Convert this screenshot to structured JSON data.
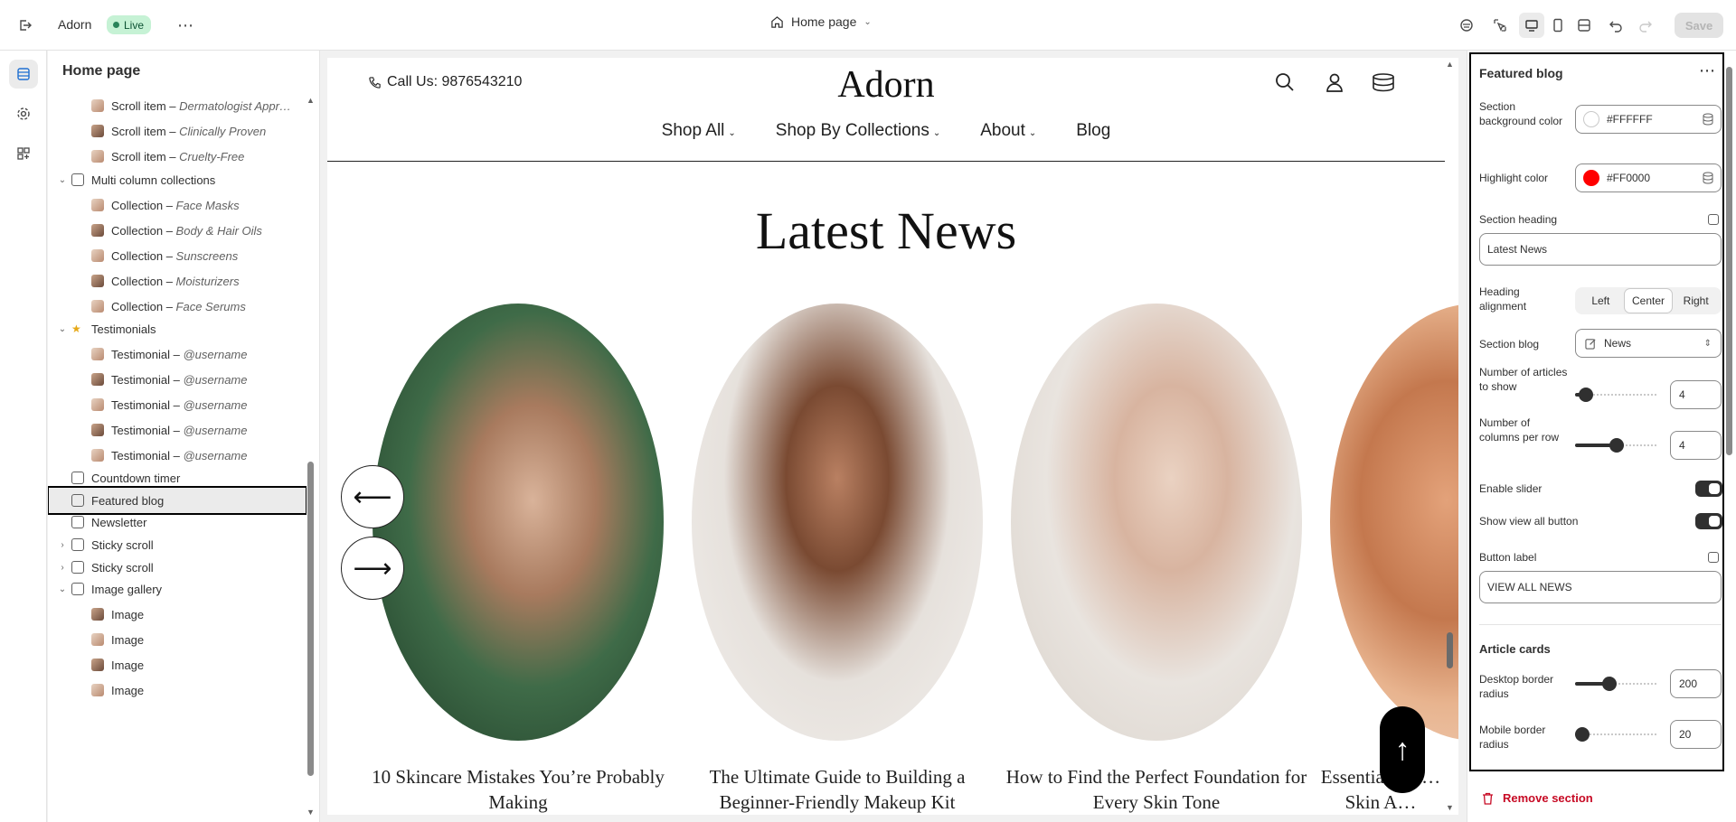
{
  "topbar": {
    "store_name": "Adorn",
    "status_badge": "Live",
    "page_selector": "Home page",
    "save_label": "Save"
  },
  "sidebar": {
    "title": "Home page",
    "items": [
      {
        "label": "Scroll item – ",
        "sub": "Dermatologist Appr…",
        "level": 2
      },
      {
        "label": "Scroll item – ",
        "sub": "Clinically Proven",
        "level": 2
      },
      {
        "label": "Scroll item – ",
        "sub": "Cruelty-Free",
        "level": 2
      },
      {
        "label": "Multi column collections",
        "sub": "",
        "level": 1
      },
      {
        "label": "Collection – ",
        "sub": "Face Masks",
        "level": 2
      },
      {
        "label": "Collection – ",
        "sub": "Body & Hair Oils",
        "level": 2
      },
      {
        "label": "Collection – ",
        "sub": "Sunscreens",
        "level": 2
      },
      {
        "label": "Collection – ",
        "sub": "Moisturizers",
        "level": 2
      },
      {
        "label": "Collection – ",
        "sub": "Face Serums",
        "level": 2
      },
      {
        "label": "Testimonials",
        "sub": "",
        "level": 1
      },
      {
        "label": "Testimonial – ",
        "sub": "@username",
        "level": 2
      },
      {
        "label": "Testimonial – ",
        "sub": "@username",
        "level": 2
      },
      {
        "label": "Testimonial – ",
        "sub": "@username",
        "level": 2
      },
      {
        "label": "Testimonial – ",
        "sub": "@username",
        "level": 2
      },
      {
        "label": "Testimonial – ",
        "sub": "@username",
        "level": 2
      },
      {
        "label": "Countdown timer",
        "sub": "",
        "level": 1
      },
      {
        "label": "Featured blog",
        "sub": "",
        "level": 1
      },
      {
        "label": "Newsletter",
        "sub": "",
        "level": 1
      },
      {
        "label": "Sticky scroll",
        "sub": "",
        "level": 1
      },
      {
        "label": "Sticky scroll",
        "sub": "",
        "level": 1
      },
      {
        "label": "Image gallery",
        "sub": "",
        "level": 1
      },
      {
        "label": "Image",
        "sub": "",
        "level": 2
      },
      {
        "label": "Image",
        "sub": "",
        "level": 2
      },
      {
        "label": "Image",
        "sub": "",
        "level": 2
      },
      {
        "label": "Image",
        "sub": "",
        "level": 2
      }
    ]
  },
  "preview": {
    "call_us": "Call Us: 9876543210",
    "logo": "Adorn",
    "nav": [
      "Shop All",
      "Shop By Collections",
      "About",
      "Blog"
    ],
    "heading": "Latest News",
    "cards": [
      {
        "title": "10 Skincare Mistakes You’re Probably Making"
      },
      {
        "title": "The Ultimate Guide to Building a Beginner-Friendly Makeup Kit"
      },
      {
        "title": "How to Find the Perfect Foundation for Every Skin Tone"
      },
      {
        "title": "Essential Sea… Skin A…"
      }
    ],
    "prev_arrow": "⟵",
    "next_arrow": "⟶",
    "back_to_top": "↑"
  },
  "settings": {
    "title": "Featured blog",
    "section_bg_label": "Section background color",
    "section_bg_value": "#FFFFFF",
    "highlight_label": "Highlight color",
    "highlight_value": "#FF0000",
    "heading_label": "Section heading",
    "heading_value": "Latest News",
    "alignment_label": "Heading alignment",
    "alignment_options": [
      "Left",
      "Center",
      "Right"
    ],
    "alignment_selected": "Center",
    "blog_label": "Section blog",
    "blog_value": "News",
    "articles_label": "Number of articles to show",
    "articles_value": "4",
    "columns_label": "Number of columns per row",
    "columns_value": "4",
    "slider_label": "Enable slider",
    "view_all_label": "Show view all button",
    "button_label_label": "Button label",
    "button_label_value": "VIEW ALL NEWS",
    "article_cards_heading": "Article cards",
    "desktop_radius_label": "Desktop border radius",
    "desktop_radius_value": "200",
    "mobile_radius_label": "Mobile border radius",
    "mobile_radius_value": "20",
    "remove_label": "Remove section"
  },
  "colors": {
    "live_badge_bg": "#c6f2d5",
    "highlight": "#FF0000",
    "remove": "#c70a24"
  },
  "icons": [
    "exit-icon",
    "more-icon",
    "home-icon",
    "chevron-down-icon",
    "inspect-icon",
    "desktop-icon",
    "mobile-icon",
    "fullwidth-icon",
    "undo-icon",
    "redo-icon",
    "sections-icon",
    "gear-icon",
    "apps-icon",
    "phone-icon",
    "search-icon",
    "account-icon",
    "cart-icon",
    "database-icon",
    "trash-icon"
  ]
}
